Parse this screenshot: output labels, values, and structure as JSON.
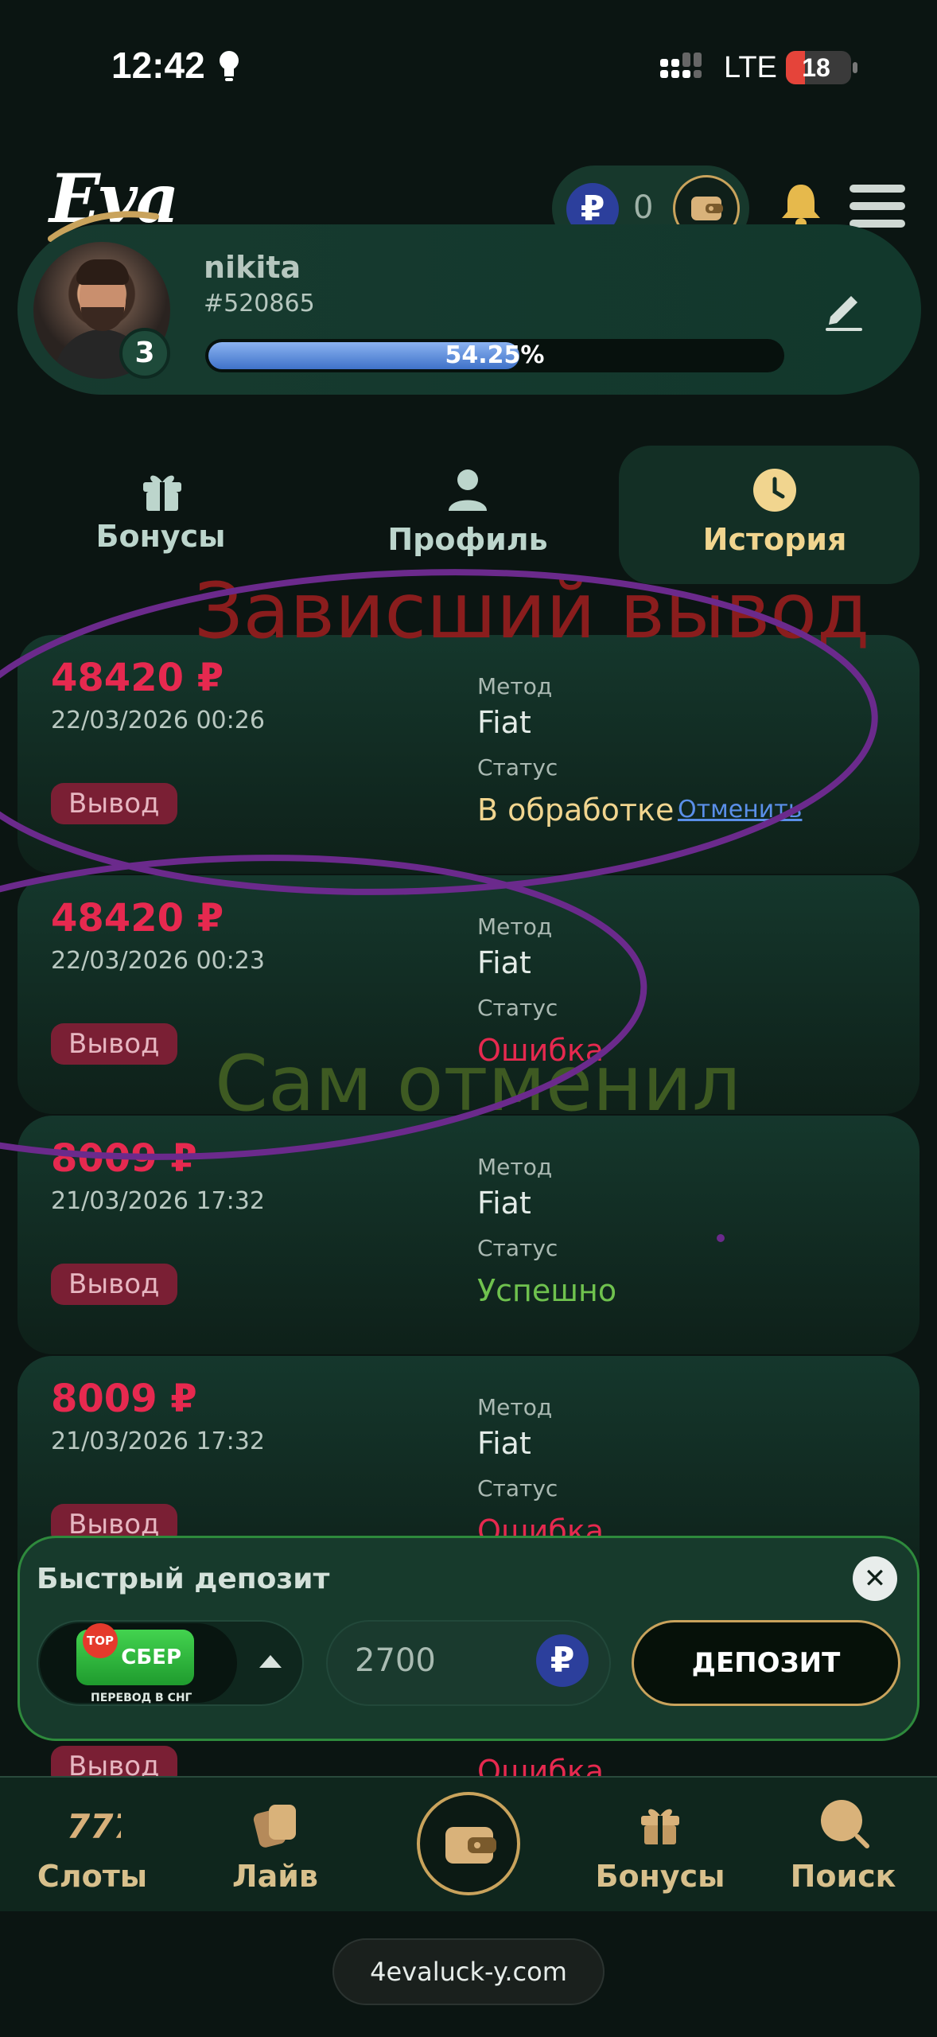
{
  "status_bar": {
    "time": "12:42",
    "network": "LTE",
    "battery": "18"
  },
  "header": {
    "logo": "Eva",
    "balance": "0",
    "currency_symbol": "₽"
  },
  "profile": {
    "username": "nikita",
    "user_id": "#520865",
    "level": "3",
    "progress_label": "54.25%",
    "progress_fraction": 0.5425
  },
  "tabs": [
    {
      "label": "Бонусы",
      "active": false
    },
    {
      "label": "Профиль",
      "active": false
    },
    {
      "label": "История",
      "active": true
    }
  ],
  "annotations": {
    "stuck_withdrawal": "Зависший вывод",
    "self_cancelled": "Сам отменил"
  },
  "transactions": [
    {
      "amount": "48420 ₽",
      "date": "22/03/2026 00:26",
      "type": "Вывод",
      "method_label": "Метод",
      "method": "Fiat",
      "status_label": "Статус",
      "status": "В обработке",
      "action": "Отменить"
    },
    {
      "amount": "48420 ₽",
      "date": "22/03/2026 00:23",
      "type": "Вывод",
      "method_label": "Метод",
      "method": "Fiat",
      "status_label": "Статус",
      "status": "Ошибка"
    },
    {
      "amount": "8009 ₽",
      "date": "21/03/2026 17:32",
      "type": "Вывод",
      "method_label": "Метод",
      "method": "Fiat",
      "status_label": "Статус",
      "status": "Успешно"
    },
    {
      "amount": "8009 ₽",
      "date": "21/03/2026 17:32",
      "type": "Вывод",
      "method_label": "Метод",
      "method": "Fiat",
      "status_label": "Статус",
      "status": "Ошибка"
    }
  ],
  "hidden_row": {
    "type": "Вывод",
    "status": "Ошибка"
  },
  "quick_deposit": {
    "title": "Быстрый депозит",
    "method_badge": "TOP",
    "method_name": "СБЕР",
    "method_sub": "ПЕРЕВОД В СНГ",
    "amount": "2700",
    "currency_symbol": "₽",
    "button": "ДЕПОЗИТ",
    "close": "✕"
  },
  "bottom_nav": [
    {
      "label": "Слоты"
    },
    {
      "label": "Лайв"
    },
    {
      "label": "Бонусы"
    },
    {
      "label": "Поиск"
    }
  ],
  "url": "4evaluck-y.com",
  "colors": {
    "background": "#0b1512",
    "accent_gold": "#c9a35c",
    "amount_red": "#e6294f",
    "status_pending": "#f1d58f",
    "status_ok": "#6fc24e",
    "annotation_purple": "#6b2a8c"
  }
}
